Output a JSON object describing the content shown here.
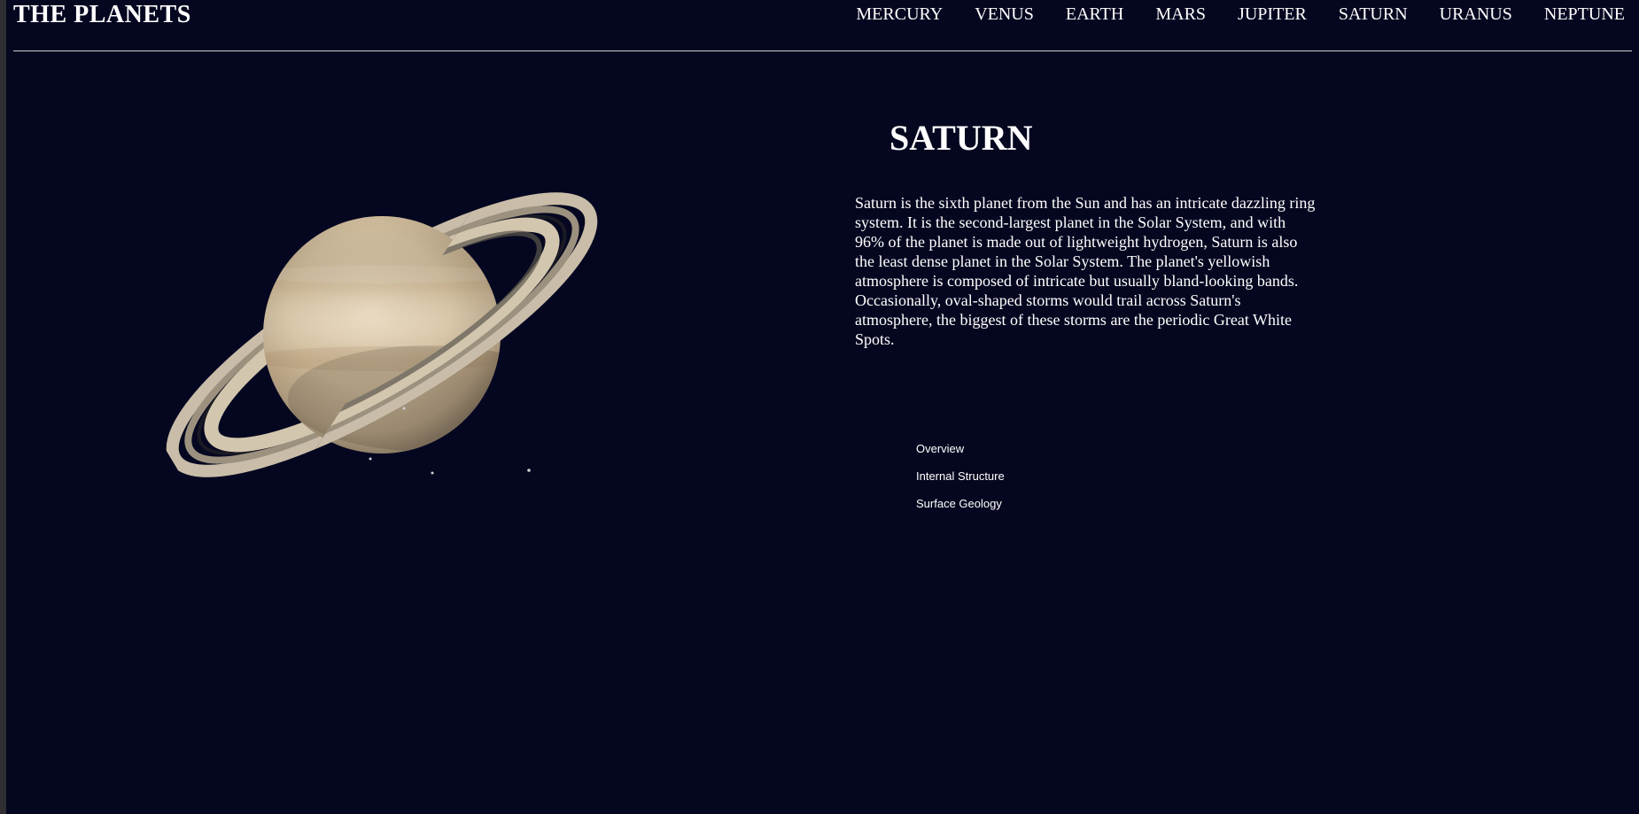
{
  "header": {
    "brand": "THE PLANETS",
    "nav": [
      "MERCURY",
      "VENUS",
      "EARTH",
      "MARS",
      "JUPITER",
      "SATURN",
      "URANUS",
      "NEPTUNE"
    ]
  },
  "planet": {
    "name": "SATURN",
    "description": "Saturn is the sixth planet from the Sun and has an intricate dazzling ring system. It is the second-largest planet in the Solar System, and with 96% of the planet is made out of lightweight hydrogen, Saturn is also the least dense planet in the Solar System. The planet's yellowish atmosphere is composed of intricate but usually bland-looking bands. Occasionally, oval-shaped storms would trail across Saturn's atmosphere, the biggest of these storms are the periodic Great White Spots."
  },
  "sections": [
    "Overview",
    "Internal Structure",
    "Surface Geology"
  ],
  "colors": {
    "background": "#050720",
    "text": "#ffffff",
    "divider": "#cfd0d8"
  }
}
